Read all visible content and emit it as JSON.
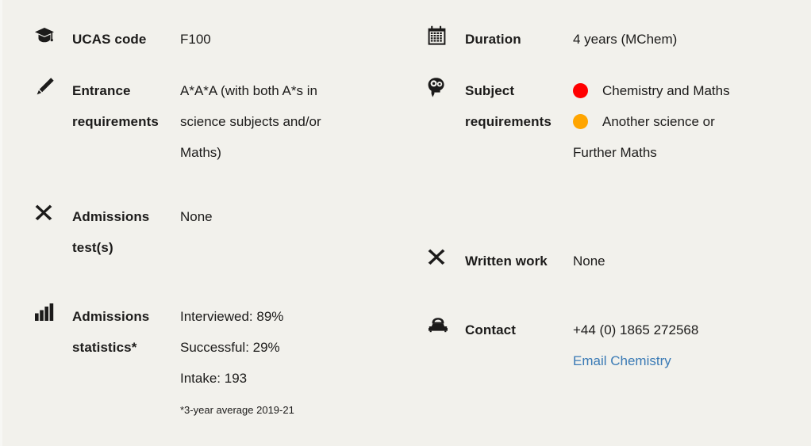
{
  "theme": {
    "background": "#f2f1ec",
    "text": "#1c1b1a",
    "link": "#3a7ab5",
    "dot_red": "#ff0000",
    "dot_orange": "#ffa500"
  },
  "left_column": [
    {
      "icon": "graduation-cap-icon",
      "label": "UCAS code",
      "value_lines": [
        "F100"
      ]
    },
    {
      "icon": "pencil-icon",
      "label": "Entrance requirements",
      "value_lines": [
        "A*A*A (with both A*s in",
        "science subjects and/or",
        "Maths)"
      ]
    },
    {
      "icon": "cross-mark-icon",
      "label": "Admissions test(s)",
      "value_lines": [
        "None"
      ]
    },
    {
      "icon": "bar-chart-icon",
      "label": "Admissions statistics*",
      "value_lines": [
        "Interviewed: 89%",
        "Successful: 29%",
        "Intake: 193"
      ],
      "footnote": "*3-year average 2019-21"
    }
  ],
  "right_column": [
    {
      "icon": "calendar-icon",
      "label": "Duration",
      "value_lines": [
        "4 years (MChem)"
      ]
    },
    {
      "icon": "brain-head-icon",
      "label": "Subject requirements",
      "requirements": [
        {
          "dot_color": "#ff0000",
          "dot_name": "red-dot",
          "text": "Chemistry and Maths"
        },
        {
          "dot_color": "#ffa500",
          "dot_name": "orange-dot",
          "text": "Another science or"
        }
      ],
      "requirements_continuation": "Further Maths"
    },
    {
      "icon": "cross-mark-icon",
      "label": "Written work",
      "value_lines": [
        "None"
      ]
    },
    {
      "icon": "telephone-icon",
      "label": "Contact",
      "phone": "+44 (0) 1865 272568",
      "email_link": "Email Chemistry"
    }
  ]
}
